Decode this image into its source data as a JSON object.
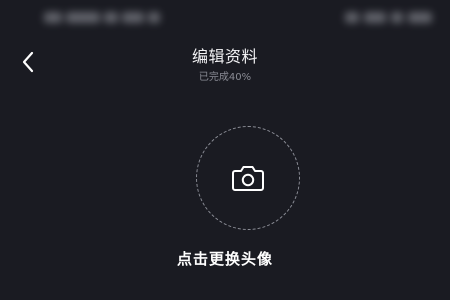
{
  "header": {
    "title": "编辑资料",
    "completion": "已完成40%"
  },
  "icons": {
    "back": "chevron-left-icon",
    "camera": "camera-icon"
  },
  "avatar": {
    "change_label": "点击更换头像"
  },
  "colors": {
    "background": "#1a1b22",
    "title": "#f2f2f4",
    "subtitle": "#8a8c95",
    "dashed_border": "#8d8f98"
  }
}
